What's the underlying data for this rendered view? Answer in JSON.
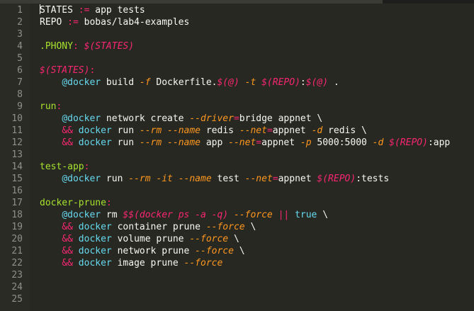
{
  "editor": {
    "lines": [
      {
        "n": "1",
        "tokens": [
          [
            "var",
            "STATES"
          ],
          [
            "op",
            " := "
          ],
          [
            "val",
            "app tests"
          ]
        ]
      },
      {
        "n": "2",
        "tokens": [
          [
            "var",
            "REPO"
          ],
          [
            "op",
            " := "
          ],
          [
            "val",
            "bobas/lab4-examples"
          ]
        ]
      },
      {
        "n": "3",
        "tokens": []
      },
      {
        "n": "4",
        "tokens": [
          [
            "special",
            ".PHONY"
          ],
          [
            "punct",
            ": "
          ],
          [
            "ref",
            "$(STATES)"
          ]
        ]
      },
      {
        "n": "5",
        "tokens": []
      },
      {
        "n": "6",
        "tokens": [
          [
            "ref",
            "$(STATES)"
          ],
          [
            "punct",
            ":"
          ]
        ]
      },
      {
        "n": "7",
        "tokens": [
          [
            "cmd",
            "    "
          ],
          [
            "at",
            "@docker"
          ],
          [
            "cmd",
            " build "
          ],
          [
            "flag",
            "-f"
          ],
          [
            "cmd",
            " Dockerfile."
          ],
          [
            "ref",
            "$(@)"
          ],
          [
            "cmd",
            " "
          ],
          [
            "flag",
            "-t"
          ],
          [
            "cmd",
            " "
          ],
          [
            "ref",
            "$(REPO)"
          ],
          [
            "cmd",
            ":"
          ],
          [
            "ref",
            "$(@)"
          ],
          [
            "cmd",
            " ."
          ]
        ]
      },
      {
        "n": "8",
        "tokens": []
      },
      {
        "n": "9",
        "tokens": [
          [
            "target",
            "run"
          ],
          [
            "punct",
            ":"
          ]
        ]
      },
      {
        "n": "10",
        "tokens": [
          [
            "cmd",
            "    "
          ],
          [
            "at",
            "@docker"
          ],
          [
            "cmd",
            " network create "
          ],
          [
            "flag",
            "--driver"
          ],
          [
            "punct",
            "="
          ],
          [
            "cmd",
            "bridge appnet \\"
          ]
        ]
      },
      {
        "n": "11",
        "tokens": [
          [
            "cmd",
            "    "
          ],
          [
            "and",
            "&&"
          ],
          [
            "cmd",
            " "
          ],
          [
            "bin",
            "docker"
          ],
          [
            "cmd",
            " run "
          ],
          [
            "flag",
            "--rm"
          ],
          [
            "cmd",
            " "
          ],
          [
            "flag",
            "--name"
          ],
          [
            "cmd",
            " redis "
          ],
          [
            "flag",
            "--net"
          ],
          [
            "punct",
            "="
          ],
          [
            "cmd",
            "appnet "
          ],
          [
            "flag",
            "-d"
          ],
          [
            "cmd",
            " redis \\"
          ]
        ]
      },
      {
        "n": "12",
        "tokens": [
          [
            "cmd",
            "    "
          ],
          [
            "and",
            "&&"
          ],
          [
            "cmd",
            " "
          ],
          [
            "bin",
            "docker"
          ],
          [
            "cmd",
            " run "
          ],
          [
            "flag",
            "--rm"
          ],
          [
            "cmd",
            " "
          ],
          [
            "flag",
            "--name"
          ],
          [
            "cmd",
            " app "
          ],
          [
            "flag",
            "--net"
          ],
          [
            "punct",
            "="
          ],
          [
            "cmd",
            "appnet "
          ],
          [
            "flag",
            "-p"
          ],
          [
            "cmd",
            " 5000:5000 "
          ],
          [
            "flag",
            "-d"
          ],
          [
            "cmd",
            " "
          ],
          [
            "ref",
            "$(REPO)"
          ],
          [
            "cmd",
            ":app"
          ]
        ]
      },
      {
        "n": "13",
        "tokens": []
      },
      {
        "n": "14",
        "tokens": [
          [
            "target",
            "test-app"
          ],
          [
            "punct",
            ":"
          ]
        ]
      },
      {
        "n": "15",
        "tokens": [
          [
            "cmd",
            "    "
          ],
          [
            "at",
            "@docker"
          ],
          [
            "cmd",
            " run "
          ],
          [
            "flag",
            "--rm"
          ],
          [
            "cmd",
            " "
          ],
          [
            "flag",
            "-it"
          ],
          [
            "cmd",
            " "
          ],
          [
            "flag",
            "--name"
          ],
          [
            "cmd",
            " test "
          ],
          [
            "flag",
            "--net"
          ],
          [
            "punct",
            "="
          ],
          [
            "cmd",
            "appnet "
          ],
          [
            "ref",
            "$(REPO)"
          ],
          [
            "cmd",
            ":tests"
          ]
        ]
      },
      {
        "n": "16",
        "tokens": []
      },
      {
        "n": "17",
        "tokens": [
          [
            "target",
            "docker-prune"
          ],
          [
            "punct",
            ":"
          ]
        ]
      },
      {
        "n": "18",
        "tokens": [
          [
            "cmd",
            "    "
          ],
          [
            "at",
            "@docker"
          ],
          [
            "cmd",
            " rm "
          ],
          [
            "ital",
            "$$(docker ps -a -q)"
          ],
          [
            "cmd",
            " "
          ],
          [
            "flag",
            "--force"
          ],
          [
            "cmd",
            " "
          ],
          [
            "and",
            "||"
          ],
          [
            "cmd",
            " "
          ],
          [
            "bool",
            "true"
          ],
          [
            "cmd",
            " \\"
          ]
        ]
      },
      {
        "n": "19",
        "tokens": [
          [
            "cmd",
            "    "
          ],
          [
            "and",
            "&&"
          ],
          [
            "cmd",
            " "
          ],
          [
            "bin",
            "docker"
          ],
          [
            "cmd",
            " container prune "
          ],
          [
            "flag",
            "--force"
          ],
          [
            "cmd",
            " \\"
          ]
        ]
      },
      {
        "n": "20",
        "tokens": [
          [
            "cmd",
            "    "
          ],
          [
            "and",
            "&&"
          ],
          [
            "cmd",
            " "
          ],
          [
            "bin",
            "docker"
          ],
          [
            "cmd",
            " volume prune "
          ],
          [
            "flag",
            "--force"
          ],
          [
            "cmd",
            " \\"
          ]
        ]
      },
      {
        "n": "21",
        "tokens": [
          [
            "cmd",
            "    "
          ],
          [
            "and",
            "&&"
          ],
          [
            "cmd",
            " "
          ],
          [
            "bin",
            "docker"
          ],
          [
            "cmd",
            " network prune "
          ],
          [
            "flag",
            "--force"
          ],
          [
            "cmd",
            " \\"
          ]
        ]
      },
      {
        "n": "22",
        "tokens": [
          [
            "cmd",
            "    "
          ],
          [
            "and",
            "&&"
          ],
          [
            "cmd",
            " "
          ],
          [
            "bin",
            "docker"
          ],
          [
            "cmd",
            " image prune "
          ],
          [
            "flag",
            "--force"
          ]
        ]
      },
      {
        "n": "23",
        "tokens": []
      },
      {
        "n": "24",
        "tokens": []
      },
      {
        "n": "25",
        "tokens": []
      }
    ]
  },
  "theme": {
    "background": "#272822",
    "foreground": "#f8f8f2",
    "keyword": "#f92672",
    "function": "#a6e22e",
    "builtin": "#66d9ef",
    "parameter": "#fd971f",
    "line_number": "#8f908a"
  }
}
